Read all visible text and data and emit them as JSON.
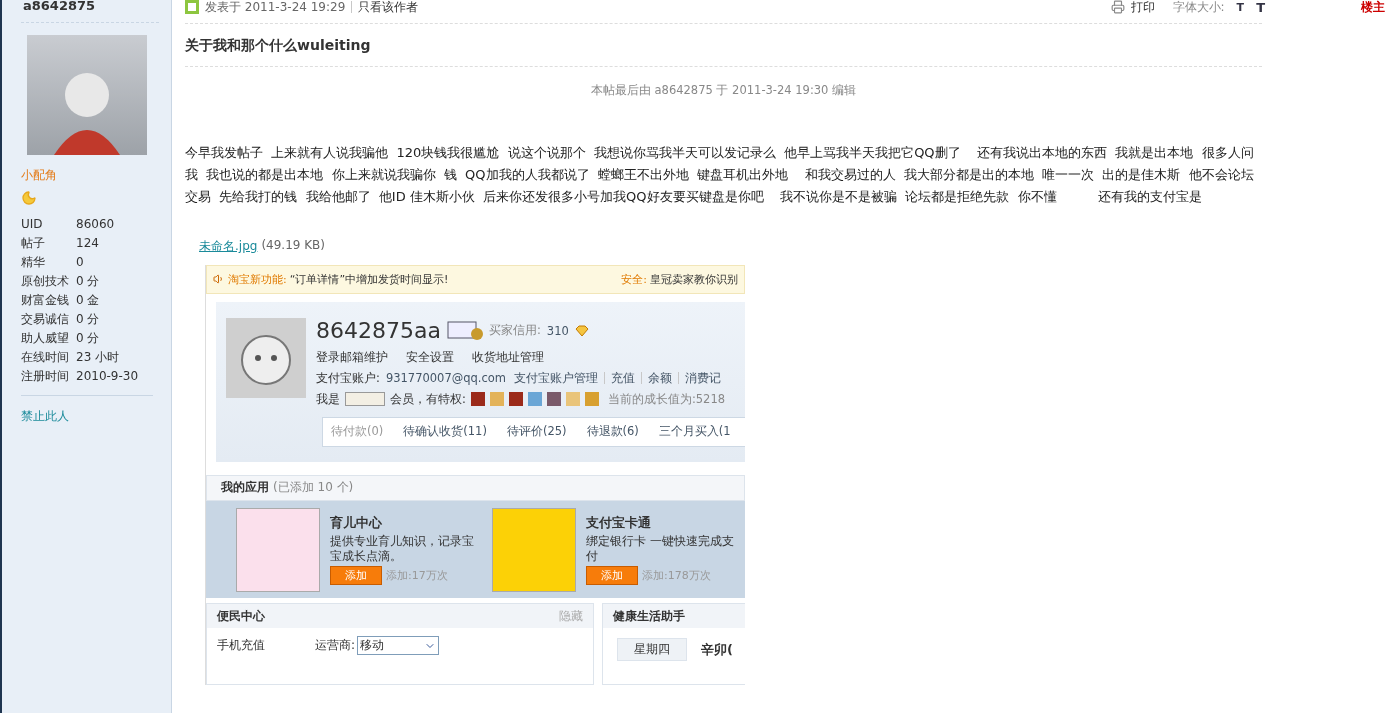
{
  "author": {
    "name": "a8642875",
    "rank": "小配角",
    "stats": [
      {
        "label": "UID",
        "value": "86060"
      },
      {
        "label": "帖子",
        "value": "124"
      },
      {
        "label": "精华",
        "value": "0"
      },
      {
        "label": "原创技术",
        "value": "0 分"
      },
      {
        "label": "财富金钱",
        "value": "0 金"
      },
      {
        "label": "交易诚信",
        "value": "0 分"
      },
      {
        "label": "助人威望",
        "value": "0 分"
      },
      {
        "label": "在线时间",
        "value": "23 小时"
      },
      {
        "label": "注册时间",
        "value": "2010-9-30"
      }
    ],
    "ban_link": "禁止此人"
  },
  "post_header": {
    "posted": "发表于 2011-3-24 19:29",
    "only_author": "只看该作者",
    "print": "打印",
    "font_size_label": "字体大小:",
    "font_sizes": [
      "T",
      "T"
    ],
    "floor": "楼主"
  },
  "post": {
    "title": "关于我和那个什么wuleiting",
    "edit_note": "本帖最后由 a8642875 于 2011-3-24 19:30 编辑",
    "body": "今早我发帖子  上来就有人说我骗他  120块钱我很尴尬  说这个说那个  我想说你骂我半天可以发记录么  他早上骂我半天我把它QQ删了    还有我说出本地的东西  我就是出本地  很多人问我  我也说的都是出本地  你上来就说我骗你  钱  QQ加我的人我都说了  螳螂王不出外地  键盘耳机出外地    和我交易过的人  我大部分都是出的本地  唯一一次  出的是佳木斯  他不会论坛交易  先给我打的钱  我给他邮了  他ID 佳木斯小伙  后来你还发很多小号加我QQ好友要买键盘是你吧    我不说你是不是被骗  论坛都是拒绝先款  你不懂          还有我的支付宝是"
  },
  "attachment": {
    "filename": "未命名.jpg",
    "size": "(49.19 KB)"
  },
  "embedded_screenshot": {
    "notice": {
      "label": "淘宝新功能:",
      "text": "“订单详情”中增加发货时间显示!",
      "security_label": "安全:",
      "security_text": "皇冠卖家教你识别"
    },
    "profile": {
      "username": "8642875aa",
      "credit_label": "买家信用:",
      "credit": "310",
      "links": [
        "登录邮箱维护",
        "安全设置",
        "收货地址管理"
      ],
      "account_label": "支付宝账户:",
      "email": "931770007@qq.com",
      "account_links": [
        "支付宝账户管理",
        "充值",
        "余额",
        "消费记"
      ],
      "member_prefix": "我是",
      "member_text": "会员，有特权:",
      "growth": "当前的成长值为:5218",
      "orders": [
        "待付款(0)",
        "待确认收货(11)",
        "待评价(25)",
        "待退款(6)",
        "三个月买入(1"
      ]
    },
    "apps": {
      "title": "我的应用",
      "count": "(已添加 10 个)",
      "items": [
        {
          "name": "育儿中心",
          "desc": "提供专业育儿知识，记录宝宝成长点滴。",
          "button": "添加",
          "count": "添加:17万次",
          "kind": "pink"
        },
        {
          "name": "支付宝卡通",
          "desc": "绑定银行卡 一键快速完成支付",
          "button": "添加",
          "count": "添加:178万次",
          "kind": "yellow"
        }
      ]
    },
    "service_panel": {
      "title": "便民中心",
      "hide": "隐藏",
      "menu": [
        "手机充值"
      ],
      "carrier_label": "运营商:",
      "carrier": "移动"
    },
    "health_panel": {
      "title": "健康生活助手",
      "weekday": "星期四",
      "lunar": "辛卯("
    }
  }
}
